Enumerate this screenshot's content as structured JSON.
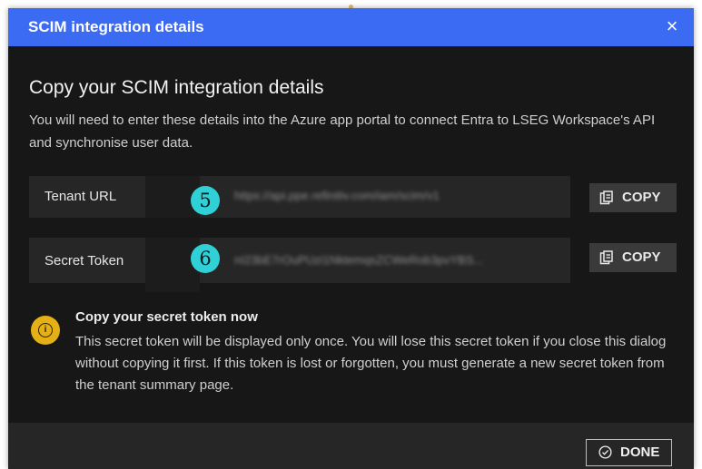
{
  "dialog": {
    "title": "SCIM integration details",
    "close_glyph": "×",
    "close_icon": "close-icon"
  },
  "content": {
    "heading": "Copy your SCIM integration details",
    "description": "You will need to enter these details into the Azure app portal to connect Entra to LSEG Workspace's API and synchronise user data."
  },
  "fields": [
    {
      "label": "Tenant URL",
      "value": "https://api.ppe.refinitiv.com/iam/scim/v1",
      "badge": "5",
      "copy_label": "COPY",
      "copy_icon": "clipboard-icon"
    },
    {
      "label": "Secret Token",
      "value": "nI23bE7rOuPUzi1NktemqsZCWeRob3pvYBS...",
      "badge": "6",
      "copy_label": "COPY",
      "copy_icon": "clipboard-icon"
    }
  ],
  "warning": {
    "icon": "info-icon",
    "icon_glyph": "i",
    "title": "Copy your secret token now",
    "text": "This secret token will be displayed only once. You will lose this secret token if you close this dialog without copying it first. If this token is lost or forgotten, you must generate a new secret token from the tenant summary page."
  },
  "footer": {
    "done_label": "DONE",
    "done_icon": "check-circle-icon"
  },
  "colors": {
    "titlebar": "#3b6af3",
    "background": "#171717",
    "badge": "#2fd0d6",
    "warning": "#e4b015"
  }
}
